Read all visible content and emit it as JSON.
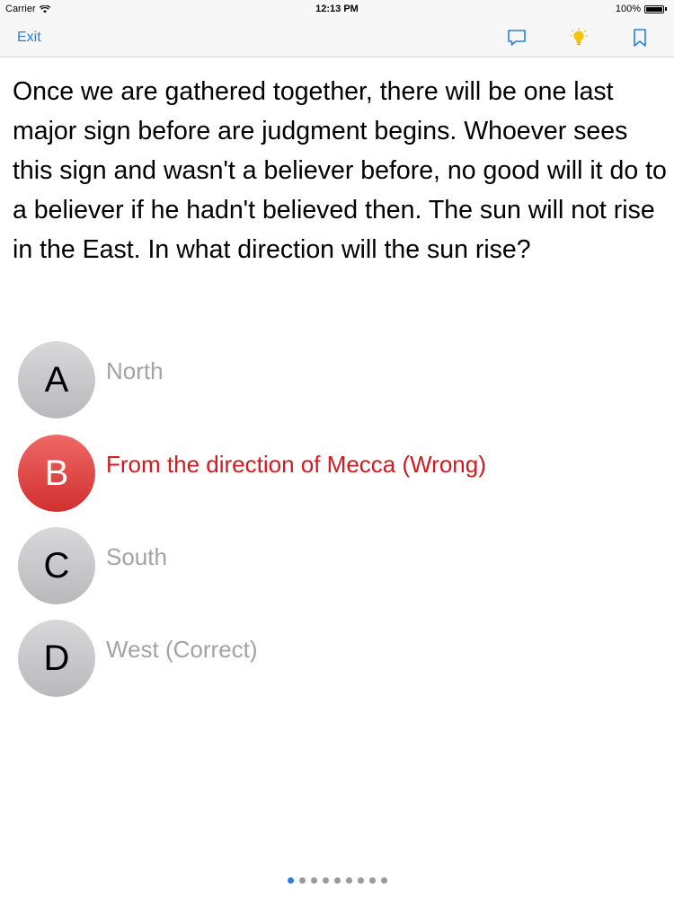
{
  "status_bar": {
    "carrier": "Carrier",
    "time": "12:13 PM",
    "battery": "100%"
  },
  "nav": {
    "exit_label": "Exit",
    "icons": [
      "comment-icon",
      "lightbulb-icon",
      "bookmark-icon"
    ]
  },
  "question": {
    "text": "Once we are gathered together, there will be one last major sign before are judgment begins. Whoever sees this sign and wasn't a believer before, no good will it do to a believer if he hadn't believed then. The sun will not rise in the East. In what direction will the sun rise?"
  },
  "options": [
    {
      "letter": "A",
      "text": "North",
      "state": "normal"
    },
    {
      "letter": "B",
      "text": "From the direction of Mecca (Wrong)",
      "state": "wrong"
    },
    {
      "letter": "C",
      "text": "South",
      "state": "normal"
    },
    {
      "letter": "D",
      "text": "West (Correct)",
      "state": "normal"
    }
  ],
  "pager": {
    "count": 9,
    "active_index": 0
  },
  "colors": {
    "accent": "#2a7fdc",
    "wrong_red": "#d21a22",
    "bulb_yellow": "#f5c400",
    "inactive_text": "#a3a3a6"
  }
}
